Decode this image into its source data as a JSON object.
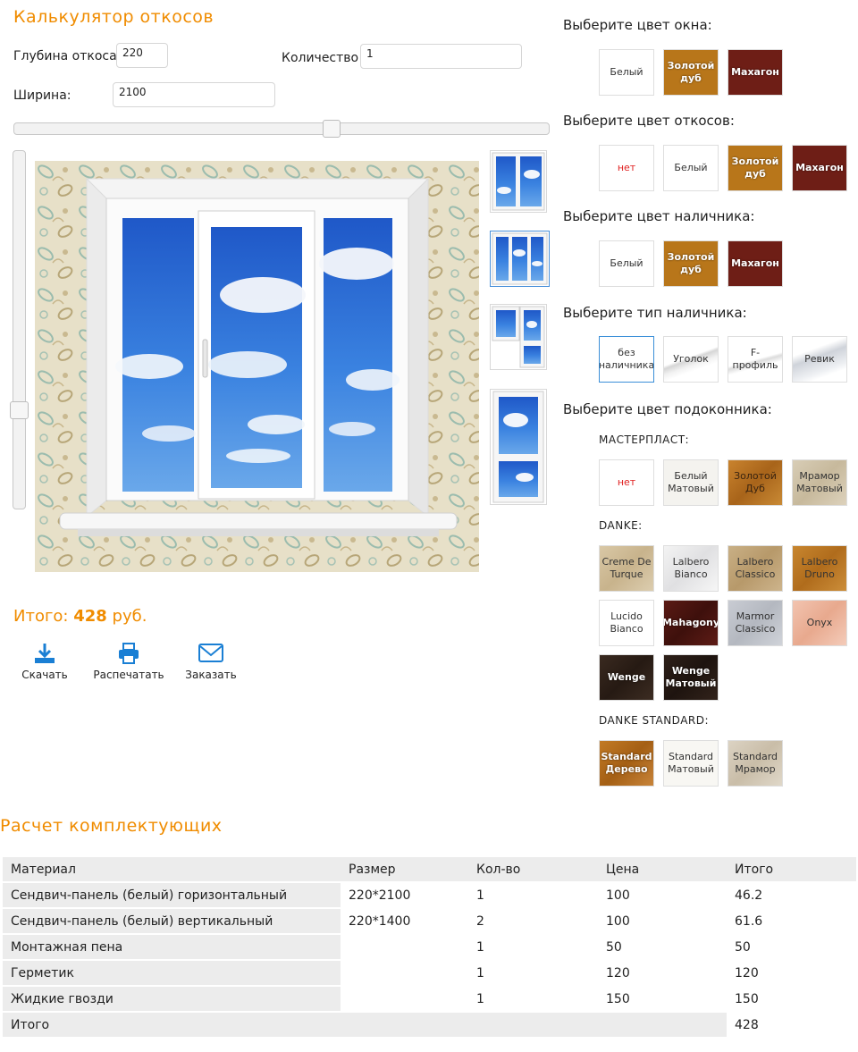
{
  "calculator": {
    "title": "Калькулятор откосов",
    "depth_label": "Глубина откоса",
    "depth_value": "220",
    "quantity_label": "Количество",
    "quantity_value": "1",
    "width_label": "Ширина:",
    "width_value": "2100",
    "total_prefix": "Итого:",
    "total_value": "428",
    "total_currency": "руб.",
    "actions": {
      "download": "Скачать",
      "print": "Распечатать",
      "order": "Заказать"
    }
  },
  "options": {
    "window_color": {
      "title": "Выберите цвет окна:",
      "items": [
        "Белый",
        "Золотой дуб",
        "Махагон"
      ]
    },
    "slope_color": {
      "title": "Выберите цвет откосов:",
      "items": [
        "нет",
        "Белый",
        "Золотой дуб",
        "Махагон"
      ]
    },
    "trim_color": {
      "title": "Выберите цвет наличника:",
      "items": [
        "Белый",
        "Золотой дуб",
        "Махагон"
      ]
    },
    "trim_type": {
      "title": "Выберите тип наличника:",
      "items": [
        "без наличника",
        "Уголок",
        "F-профиль",
        "Ревик"
      ]
    },
    "sill_color": {
      "title": "Выберите цвет подоконника:",
      "masterplast": {
        "title": "МАСТЕРПЛАСТ:",
        "items": [
          "нет",
          "Белый Матовый",
          "Золотой Дуб",
          "Мрамор Матовый"
        ]
      },
      "danke": {
        "title": "DANKE:",
        "items": [
          "Creme De Turque",
          "Lalbero Bianco",
          "Lalbero Classico",
          "Lalbero Druno",
          "Lucido Bianco",
          "Mahagony",
          "Marmor Classico",
          "Onyx",
          "Wenge",
          "Wenge Матовый"
        ]
      },
      "danke_standard": {
        "title": "DANKE STANDARD:",
        "items": [
          "Standard Дерево",
          "Standard Матовый",
          "Standard Мрамор"
        ]
      }
    }
  },
  "components": {
    "title": "Расчет комплектующих",
    "headers": [
      "Материал",
      "Размер",
      "Кол-во",
      "Цена",
      "Итого"
    ],
    "rows": [
      [
        "Сендвич-панель (белый) горизонтальный",
        "220*2100",
        "1",
        "100",
        "46.2"
      ],
      [
        "Сендвич-панель (белый) вертикальный",
        "220*1400",
        "2",
        "100",
        "61.6"
      ],
      [
        "Монтажная пена",
        "",
        "1",
        "50",
        "50"
      ],
      [
        "Герметик",
        "",
        "1",
        "120",
        "120"
      ],
      [
        "Жидкие гвозди",
        "",
        "1",
        "150",
        "150"
      ]
    ],
    "total_label": "Итого",
    "total_value": "428"
  },
  "colors": {
    "accent": "#f08c00",
    "selected_border": "#3b8fd8",
    "golden_oak": "#b8761a",
    "mahogany": "#6e1e16",
    "wenge": "#2e2019"
  }
}
